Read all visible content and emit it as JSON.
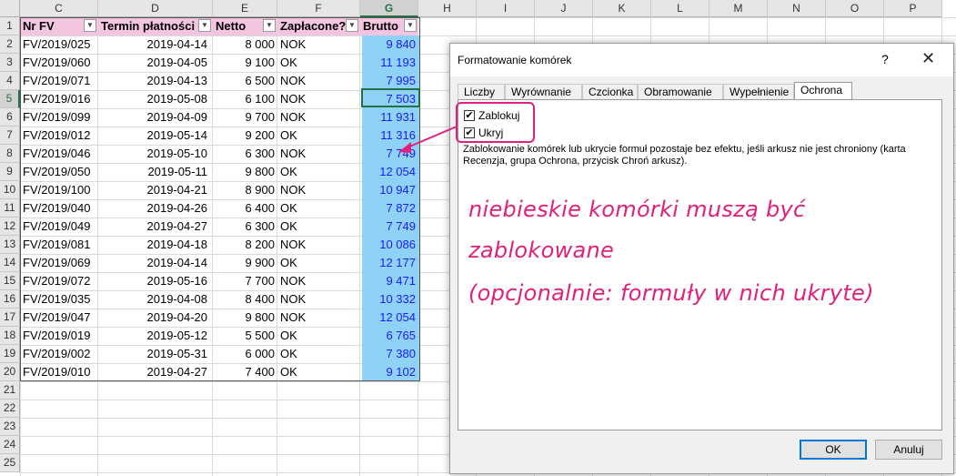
{
  "spreadsheet": {
    "columns": [
      "C",
      "D",
      "E",
      "F",
      "G",
      "H",
      "I",
      "J",
      "K",
      "L",
      "M",
      "N",
      "O",
      "P"
    ],
    "rows": [
      "1",
      "2",
      "3",
      "4",
      "5",
      "6",
      "7",
      "8",
      "9",
      "10",
      "11",
      "12",
      "13",
      "14",
      "15",
      "16",
      "17",
      "18",
      "19",
      "20",
      "21",
      "22",
      "23",
      "24",
      "25"
    ],
    "selected_column": "G",
    "selected_row": "5",
    "headers": [
      "Nr FV",
      "Termin płatności",
      "Netto",
      "Zapłacone?",
      "Brutto"
    ],
    "filter_icon": "dropdown-arrow-icon",
    "highlight_color": "#8ed3f7",
    "header_color": "#f4c5e0",
    "data": [
      [
        "FV/2019/025",
        "2019-04-14",
        "8 000",
        "NOK",
        "9 840"
      ],
      [
        "FV/2019/060",
        "2019-04-05",
        "9 100",
        "OK",
        "11 193"
      ],
      [
        "FV/2019/071",
        "2019-04-13",
        "6 500",
        "NOK",
        "7 995"
      ],
      [
        "FV/2019/016",
        "2019-05-08",
        "6 100",
        "NOK",
        "7 503"
      ],
      [
        "FV/2019/099",
        "2019-04-09",
        "9 700",
        "NOK",
        "11 931"
      ],
      [
        "FV/2019/012",
        "2019-05-14",
        "9 200",
        "OK",
        "11 316"
      ],
      [
        "FV/2019/046",
        "2019-05-10",
        "6 300",
        "NOK",
        "7 749"
      ],
      [
        "FV/2019/050",
        "2019-05-11",
        "9 800",
        "OK",
        "12 054"
      ],
      [
        "FV/2019/100",
        "2019-04-21",
        "8 900",
        "NOK",
        "10 947"
      ],
      [
        "FV/2019/040",
        "2019-04-26",
        "6 400",
        "OK",
        "7 872"
      ],
      [
        "FV/2019/049",
        "2019-04-27",
        "6 300",
        "OK",
        "7 749"
      ],
      [
        "FV/2019/081",
        "2019-04-18",
        "8 200",
        "NOK",
        "10 086"
      ],
      [
        "FV/2019/069",
        "2019-04-14",
        "9 900",
        "OK",
        "12 177"
      ],
      [
        "FV/2019/072",
        "2019-05-16",
        "7 700",
        "NOK",
        "9 471"
      ],
      [
        "FV/2019/035",
        "2019-04-08",
        "8 400",
        "NOK",
        "10 332"
      ],
      [
        "FV/2019/047",
        "2019-04-20",
        "9 800",
        "NOK",
        "12 054"
      ],
      [
        "FV/2019/019",
        "2019-05-12",
        "5 500",
        "OK",
        "6 765"
      ],
      [
        "FV/2019/002",
        "2019-05-31",
        "6 000",
        "OK",
        "7 380"
      ],
      [
        "FV/2019/010",
        "2019-04-27",
        "7 400",
        "OK",
        "9 102"
      ]
    ]
  },
  "dialog": {
    "title": "Formatowanie komórek",
    "help": "?",
    "close": "✕",
    "tabs": [
      "Liczby",
      "Wyrównanie",
      "Czcionka",
      "Obramowanie",
      "Wypełnienie",
      "Ochrona"
    ],
    "active_tab": "Ochrona",
    "lock_label": "Zablokuj",
    "hide_label": "Ukryj",
    "lock_checked": true,
    "hide_checked": true,
    "info_line1": "Zablokowanie komórek lub ukrycie formuł pozostaje bez efektu, jeśli arkusz nie jest chroniony (karta",
    "info_line2": "Recenzja, grupa Ochrona, przycisk Chroń arkusz).",
    "ok": "OK",
    "cancel": "Anuluj"
  },
  "annotation": {
    "line1": "niebieskie komórki muszą być",
    "line2": "zablokowane",
    "line3": "(opcjonalnie: formuły w nich ukryte)",
    "color": "#e0207a"
  }
}
